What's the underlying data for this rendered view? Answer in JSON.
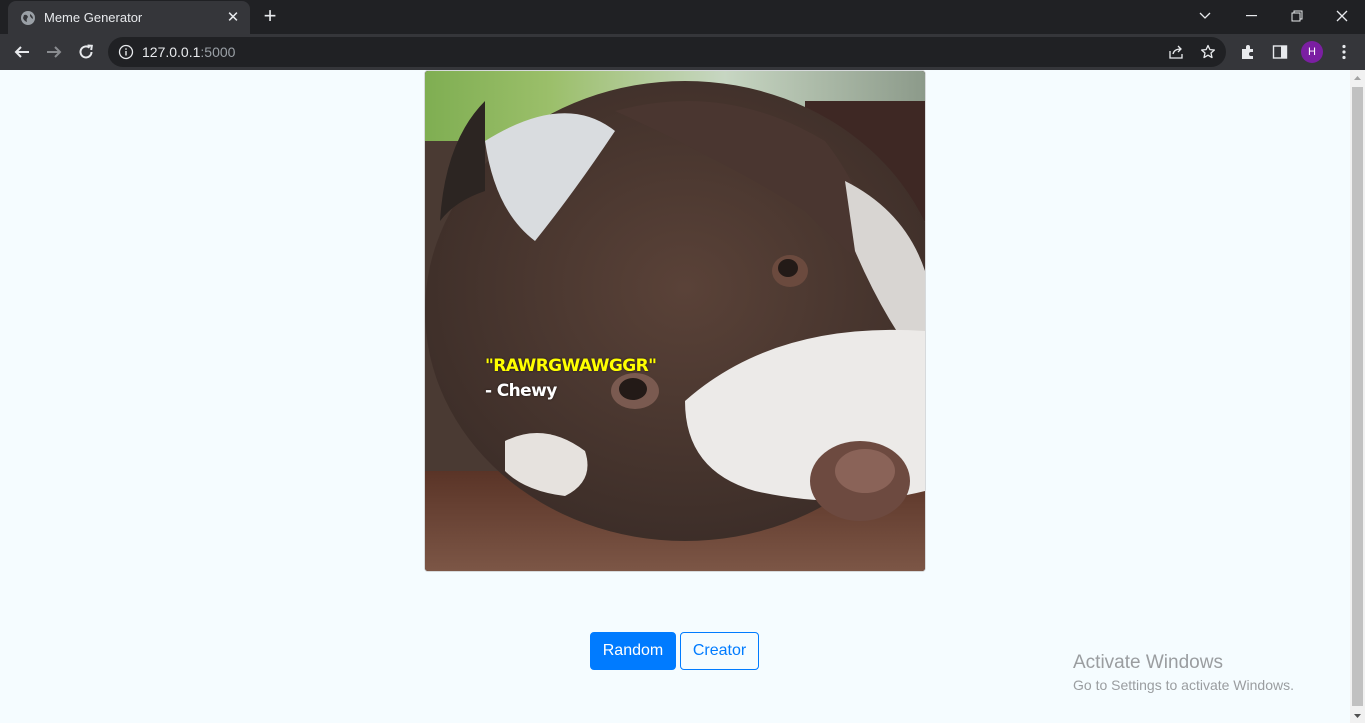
{
  "browser": {
    "tab_title": "Meme Generator",
    "url_host": "127.0.0.1",
    "url_port": ":5000",
    "profile_initial": "H",
    "avatar_color": "#7b1fa2"
  },
  "meme": {
    "quote": "\"RAWRGWAWGGR\"",
    "author": "- Chewy",
    "quote_color": "#ffff00",
    "author_color": "#ffffff"
  },
  "buttons": {
    "random_label": "Random",
    "creator_label": "Creator",
    "accent": "#007bff"
  },
  "watermark": {
    "title": "Activate Windows",
    "subtitle": "Go to Settings to activate Windows."
  },
  "icons": [
    "globe-icon",
    "close-icon",
    "plus-icon",
    "chevron-down-icon",
    "minimize-icon",
    "restore-icon",
    "window-close-icon",
    "back-arrow-icon",
    "forward-arrow-icon",
    "reload-icon",
    "info-icon",
    "share-icon",
    "star-icon",
    "puzzle-icon",
    "side-panel-icon",
    "kebab-menu-icon"
  ]
}
